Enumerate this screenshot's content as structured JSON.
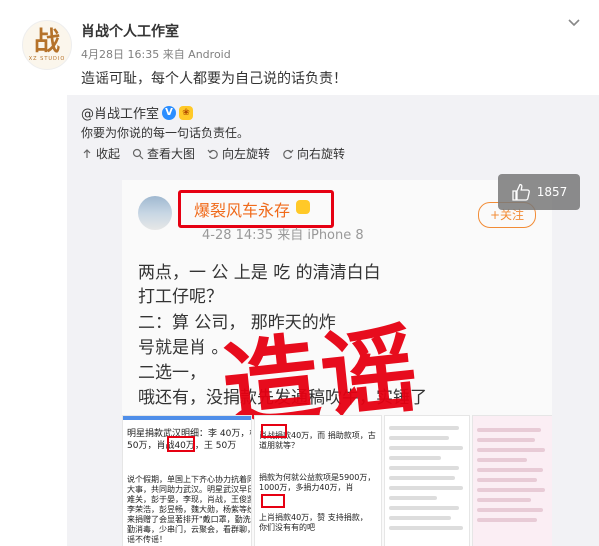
{
  "post": {
    "author": "肖战个人工作室",
    "meta": "4月28日 16:35 来自 Android",
    "text": "造谣可耻，每个人都要为自己说的话负责！",
    "avatar_glyph": "战",
    "avatar_sub": "XZ STUDIO"
  },
  "repost": {
    "author": "@肖战工作室",
    "text": "你要为你说的每一句话负责任。",
    "actions": [
      "收起",
      "查看大图",
      "向左旋转",
      "向右旋转"
    ],
    "likes": "1857"
  },
  "image": {
    "inner_name": "爆裂风车永存",
    "inner_time": "4-28 14:35 来自 iPhone 8",
    "follow": "+关注",
    "lines": [
      "两点，一       公         上是     吃        的清清白白",
      "打工仔呢？",
      "二：算          公司，          那昨天的炸",
      "号就是肖         。",
      "二选一，",
      "哦还有，没捐款先发通稿吹牛，实锤了"
    ],
    "stamp": "造谣",
    "shot1_lines": [
      "明星捐款武汉明细：李 40万，杨",
      "50万，肖战40万，王    50万"
    ],
    "shot1_body": [
      "说个假期，单国上下齐心协力抗着同一件",
      "大事，共同助力武汉。明星武汉早日度过",
      "难关，彭于晏，李现，肖战，王俊凯，",
      "李荣浩，彭昱畅，魏大勋，杨紫等纷纷",
      "来捐赠了会显著排开\"戴口罩，勤洗手，",
      "勤消毒，少串门，云聚会，看群聊，不信",
      "谣不传谣！"
    ],
    "shot2_lines": [
      "肖战捐款40万，而    捐助款项，古",
      "道朋就等？",
      "捐款为何就公益款项是5900万，",
      "1000万，多捐力40万，肖",
      "上肖捐款40万，赞     支持捐款，",
      "你们没有有的吧"
    ]
  },
  "colors": {
    "accent": "#e60012",
    "follow": "#f28c36",
    "name": "#f06a1a"
  },
  "icons": [
    "chevron-down-icon",
    "collapse-icon",
    "zoom-icon",
    "rotate-left-icon",
    "rotate-right-icon",
    "thumbs-up-icon"
  ]
}
